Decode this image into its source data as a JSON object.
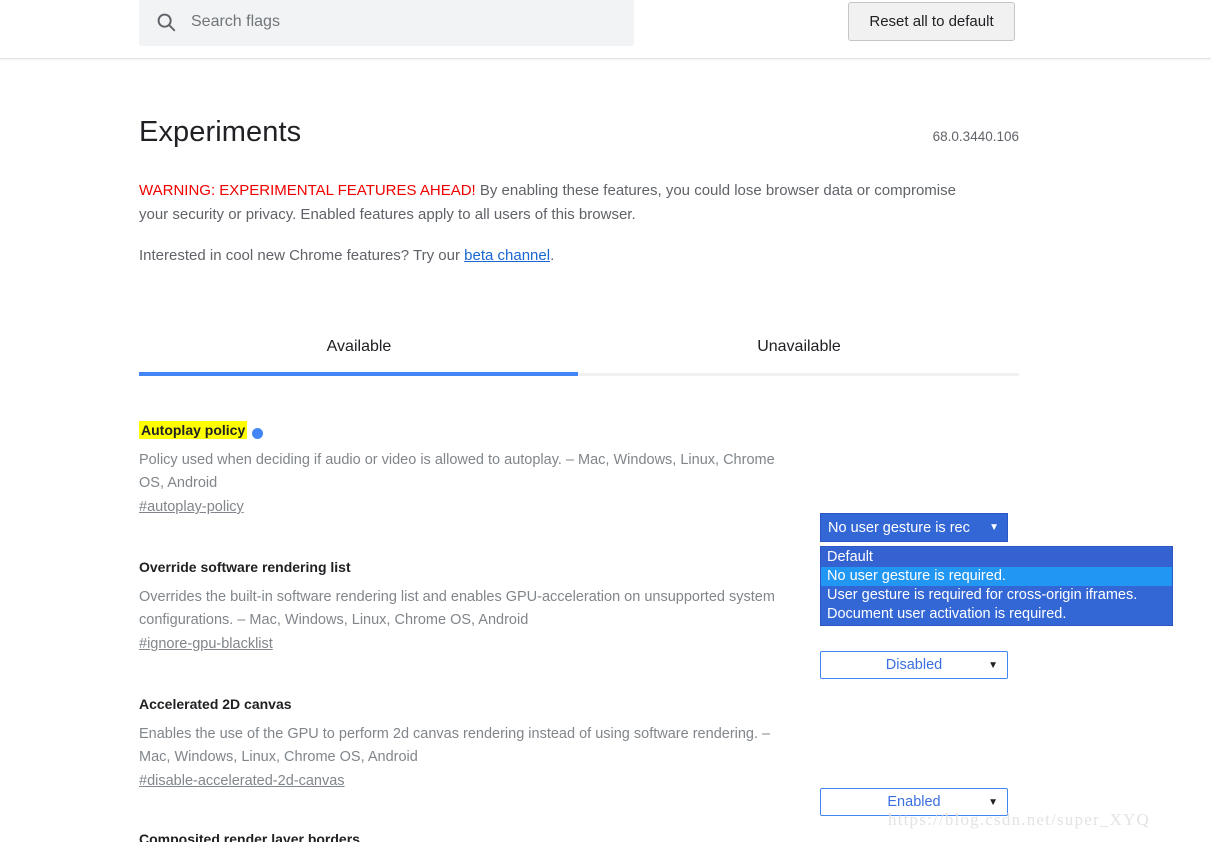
{
  "header": {
    "search": {
      "placeholder": "Search flags",
      "value": "",
      "icon": "search-icon"
    },
    "reset_button": "Reset all to default"
  },
  "page": {
    "title": "Experiments",
    "version": "68.0.3440.106",
    "warning_strong": "WARNING: EXPERIMENTAL FEATURES AHEAD!",
    "warning_rest": " By enabling these features, you could lose browser data or compromise your security or privacy. Enabled features apply to all users of this browser.",
    "beta_prefix": "Interested in cool new Chrome features? Try our ",
    "beta_link": "beta channel",
    "beta_suffix": "."
  },
  "tabs": [
    {
      "label": "Available",
      "selected": true
    },
    {
      "label": "Unavailable",
      "selected": false
    }
  ],
  "colors": {
    "accent_blue": "#4285f4",
    "select_blue": "#3367d6",
    "option_hover": "#2196f3",
    "warning_red": "#f00000",
    "highlight_yellow": "#ffff00",
    "link_blue": "#1967d2"
  },
  "flags": [
    {
      "title": "Autoplay policy",
      "highlighted": true,
      "has_dot": true,
      "description": "Policy used when deciding if audio or video is allowed to autoplay. – Mac, Windows, Linux, Chrome OS, Android",
      "permalink": "#autoplay-policy",
      "select": {
        "state": "open",
        "value": "No user gesture is rec",
        "full_value": "No user gesture is required.",
        "arrow": "chevron-down-icon",
        "options": [
          {
            "label": "Default",
            "state": "active"
          },
          {
            "label": "No user gesture is required.",
            "state": "hovered"
          },
          {
            "label": "User gesture is required for cross-origin iframes.",
            "state": "normal"
          },
          {
            "label": "Document user activation is required.",
            "state": "normal"
          }
        ]
      }
    },
    {
      "title": "Override software rendering list",
      "highlighted": false,
      "has_dot": false,
      "description": "Overrides the built-in software rendering list and enables GPU-acceleration on unsupported system configurations. – Mac, Windows, Linux, Chrome OS, Android",
      "permalink": "#ignore-gpu-blacklist",
      "select": {
        "state": "closed",
        "value": "Disabled",
        "arrow": "chevron-down-icon"
      }
    },
    {
      "title": "Accelerated 2D canvas",
      "highlighted": false,
      "has_dot": false,
      "description": "Enables the use of the GPU to perform 2d canvas rendering instead of using software rendering. – Mac, Windows, Linux, Chrome OS, Android",
      "permalink": "#disable-accelerated-2d-canvas",
      "select": {
        "state": "closed",
        "value": "Enabled",
        "arrow": "chevron-down-icon"
      }
    }
  ],
  "cut_off_flag_title": "Composited render layer borders",
  "watermark": "https://blog.csdn.net/super_XYQ"
}
